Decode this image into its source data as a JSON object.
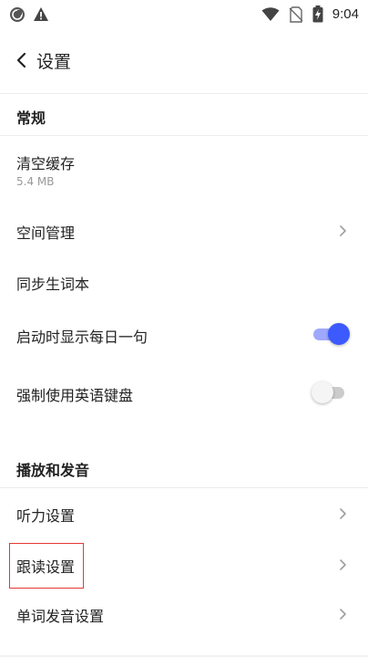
{
  "status_bar": {
    "time": "9:04",
    "icons": [
      "app-circle-icon",
      "warning-icon",
      "wifi-icon",
      "no-sim-icon",
      "battery-charging-icon"
    ]
  },
  "toolbar": {
    "title": "设置",
    "back_icon": "chevron-left-icon"
  },
  "sections": [
    {
      "header": "常规",
      "items": [
        {
          "title": "清空缓存",
          "subtitle": "5.4 MB",
          "type": "plain"
        },
        {
          "title": "空间管理",
          "type": "chevron"
        },
        {
          "title": "同步生词本",
          "type": "plain"
        },
        {
          "title": "启动时显示每日一句",
          "type": "toggle",
          "on": true
        },
        {
          "title": "强制使用英语键盘",
          "type": "toggle",
          "on": false
        }
      ]
    },
    {
      "header": "播放和发音",
      "items": [
        {
          "title": "听力设置",
          "type": "chevron"
        },
        {
          "title": "跟读设置",
          "type": "chevron",
          "highlighted": true
        },
        {
          "title": "单词发音设置",
          "type": "chevron"
        }
      ]
    }
  ],
  "colors": {
    "accent": "#3d5afe",
    "toggle_on_track": "#9fa8ff",
    "toggle_off_track": "#cccccc",
    "toggle_off_knob": "#f5f5f5",
    "highlight": "#e53935",
    "chevron": "#9e9e9e"
  }
}
